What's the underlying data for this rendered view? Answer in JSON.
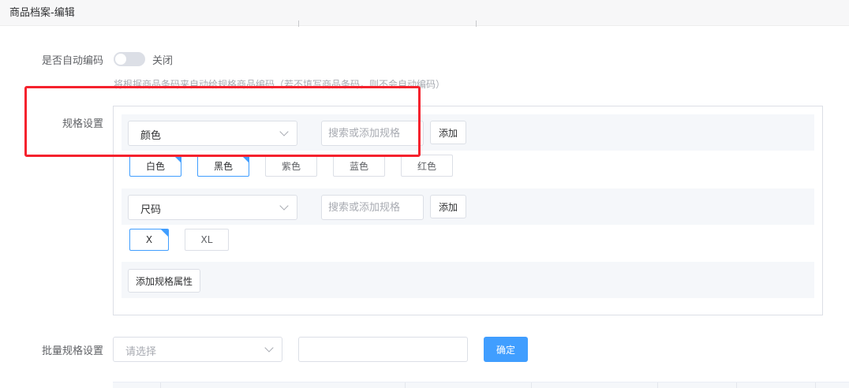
{
  "header": {
    "title": "商品档案-编辑"
  },
  "auto_code": {
    "label": "是否自动编码",
    "switch_text": "关闭",
    "hint": "将根据商品条码来自动给规格商品编码（若不填写商品条码，则不会自动编码）"
  },
  "spec": {
    "label": "规格设置",
    "groups": [
      {
        "select_value": "颜色",
        "search_placeholder": "搜索或添加规格",
        "add_label": "添加",
        "tags": [
          {
            "label": "白色",
            "selected": true
          },
          {
            "label": "黑色",
            "selected": true
          },
          {
            "label": "紫色",
            "selected": false
          },
          {
            "label": "蓝色",
            "selected": false
          },
          {
            "label": "红色",
            "selected": false
          }
        ]
      },
      {
        "select_value": "尺码",
        "search_placeholder": "搜索或添加规格",
        "add_label": "添加",
        "tags": [
          {
            "label": "X",
            "selected": true
          },
          {
            "label": "XL",
            "selected": false
          }
        ]
      }
    ],
    "add_attr_label": "添加规格属性"
  },
  "batch": {
    "label": "批量规格设置",
    "select_placeholder": "请选择",
    "input_value": "",
    "confirm_label": "确定"
  },
  "colors": {
    "primary": "#409eff",
    "highlight": "#f5222d"
  },
  "icons": {
    "select_arrow": "chevron-down-icon",
    "selected_corner": "check-corner-icon"
  }
}
